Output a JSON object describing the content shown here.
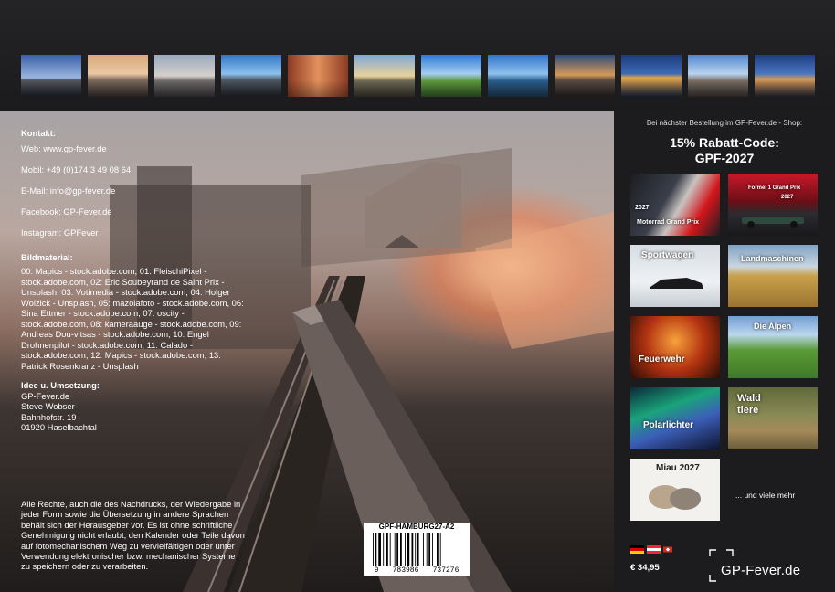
{
  "contact": {
    "heading": "Kontakt:",
    "web": "Web: www.gp-fever.de",
    "mobil": "Mobil: +49 (0)174 3 49 08 64",
    "email": "E-Mail: info@gp-fever.de",
    "facebook": "Facebook: GP-Fever.de",
    "instagram": "Instagram: GPFever"
  },
  "bildmaterial": {
    "heading": "Bildmaterial:",
    "text": "00: Mapics - stock.adobe.com, 01: FleischiPixel - stock.adobe.com, 02: Eric Soubeyrand de Saint Prix - Unsplash, 03: Votimedia - stock.adobe.com, 04: Holger Woizick - Unsplash, 05: mazolafoto - stock.adobe.com, 06: Sina Ettmer - stock.adobe.com, 07: oscity - stock.adobe.com, 08: kameraauge - stock.adobe.com, 09: Andreas Dou-vitsas - stock.adobe.com, 10: Engel Drohnenpilot - stock.adobe.com, 11: Calado - stock.adobe.com, 12: Mapics - stock.adobe.com, 13: Patrick Rosenkranz - Unsplash"
  },
  "idee": {
    "heading": "Idee u. Umsetzung:",
    "line1": "GP-Fever.de",
    "line2": "Steve Wobser",
    "line3": "Bahnhofstr. 19",
    "line4": "01920 Haselbachtal"
  },
  "rights": "Alle Rechte, auch die des Nachdrucks, der Wiedergabe in jeder Form sowie die Übersetzung in andere Sprachen behält sich der Herausgeber vor. Es ist ohne schriftliche Genehmigung nicht erlaubt, den Kalender oder Teile davon auf fotomechanischem Weg zu vervielfältigen oder unter Verwendung elektronischer bzw. mechanischer Systeme zu speichern oder zu verarbeiten.",
  "barcode": {
    "code": "GPF-HAMBURG27-A2",
    "digit1": "9",
    "digits2": "783986",
    "digits3": "737276"
  },
  "promo": {
    "note": "Bei nächster Bestellung im GP-Fever.de - Shop:",
    "line1": "15% Rabatt-Code:",
    "line2": "GPF-2027"
  },
  "calendars": {
    "motorrad_year": "2027",
    "motorrad": "Motorrad Grand Prix",
    "formel1": "Formel 1 Grand Prix",
    "formel1_year": "2027",
    "sportwagen": "Sportwagen",
    "landmaschinen": "Landmaschinen",
    "feuerwehr": "Feuerwehr",
    "alpen": "Die Alpen",
    "polarlichter": "Polarlichter",
    "wald": "Wald",
    "tiere": "tiere",
    "miau": "Miau",
    "miau_year": "2027"
  },
  "more": "... und viele mehr",
  "price": "€ 34,95",
  "logo": "GP-Fever.de",
  "colors": {
    "background": "#1c1c1e",
    "sun": "#f3a06e",
    "flag_de": [
      "#000000",
      "#dd0000",
      "#ffce00"
    ],
    "flag_at": [
      "#ed2939",
      "#ffffff",
      "#ed2939"
    ],
    "flag_ch": "#d52b1e"
  }
}
